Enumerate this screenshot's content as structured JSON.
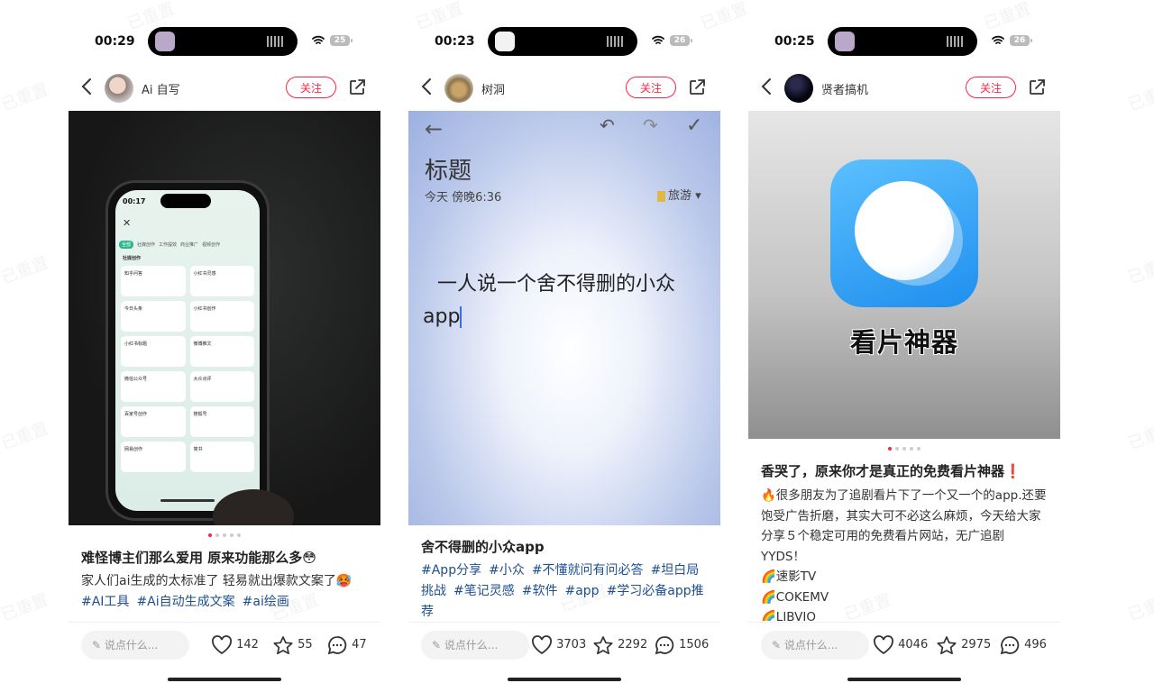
{
  "watermark_text": "已重置",
  "panels": [
    {
      "status": {
        "time": "00:29",
        "battery": "25"
      },
      "author": {
        "name": "Ai 自写"
      },
      "follow_label": "关注",
      "phone_ui": {
        "time": "00:17",
        "tabs": [
          "全部",
          "社媒创作",
          "工作提效",
          "商业推广",
          "视频创作"
        ],
        "section": "社媒创作",
        "cards": [
          "知乎问答",
          "小红书灵感",
          "今日头条",
          "小红书创作",
          "小红书标题",
          "微博推文",
          "微信公众号",
          "大众点评",
          "百家号创作",
          "搜狐号",
          "网易创作",
          "简书"
        ]
      },
      "title": "难怪博主们那么爱用 原来功能那么多😳",
      "body": "家人们ai生成的太标准了 轻易就出爆款文案了🥵",
      "tags": [
        "#AI工具",
        "#Ai自动生成文案",
        "#ai绘画"
      ],
      "comment_placeholder": "说点什么...",
      "likes": "142",
      "favorites": "55",
      "comments": "47"
    },
    {
      "status": {
        "time": "00:23",
        "battery": "26"
      },
      "author": {
        "name": "树洞"
      },
      "follow_label": "关注",
      "note_ui": {
        "heading": "标题",
        "date": "今天 傍晚6:36",
        "folder": "旅游",
        "line1": "一人说一个舍不得删的小众",
        "line2": "app"
      },
      "title": "舍不得删的小众app",
      "tags": [
        "#App分享",
        "#小众",
        "#不懂就问有问必答",
        "#坦白局挑战",
        "#笔记灵感",
        "#软件",
        "#app",
        "#学习必备app推荐"
      ],
      "comment_placeholder": "说点什么...",
      "likes": "3703",
      "favorites": "2292",
      "comments": "1506"
    },
    {
      "status": {
        "time": "00:25",
        "battery": "26"
      },
      "author": {
        "name": "贤者搞机"
      },
      "follow_label": "关注",
      "image_caption": "看片神器",
      "title": "香哭了，原来你才是真正的免费看片神器❗",
      "body_lines": [
        "🔥很多朋友为了追剧看片下了一个又一个的app.还要饱受广告折磨，其实大可不必这么麻烦，今天给大家分享５个稳定可用的免费看片网站，无广追剧YYDS！",
        "🌈速影TV",
        "🌈COKEMV",
        "🌈LIBVIO"
      ],
      "comment_placeholder": "说点什么...",
      "likes": "4046",
      "favorites": "2975",
      "comments": "496"
    }
  ],
  "colors": {
    "accent": "#ff2442",
    "tag": "#1f4f8f"
  }
}
